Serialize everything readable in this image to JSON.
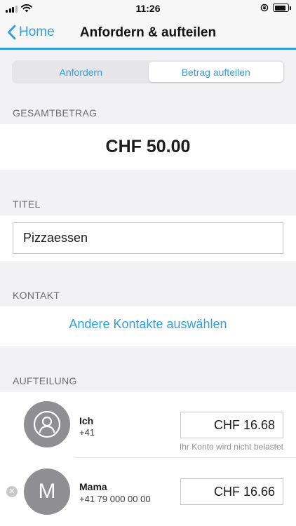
{
  "status_bar": {
    "time": "11:26"
  },
  "nav": {
    "back_label": "Home",
    "title": "Anfordern & aufteilen"
  },
  "segments": [
    {
      "label": "Anfordern",
      "active": false
    },
    {
      "label": "Betrag aufteilen",
      "active": true
    }
  ],
  "total": {
    "label": "GESAMTBETRAG",
    "value": "CHF 50.00"
  },
  "title_section": {
    "label": "TITEL",
    "value": "Pizzaessen"
  },
  "contact_section": {
    "label": "KONTAKT",
    "link": "Andere Kontakte auswählen"
  },
  "split_section": {
    "label": "AUFTEILUNG",
    "people": [
      {
        "name": "Ich",
        "phone": "+41",
        "amount": "CHF 16.68",
        "note": "Ihr Konto wird nicht belastet",
        "avatar": "person-icon"
      },
      {
        "name": "Mama",
        "phone": "+41 79 000 00 00",
        "amount": "CHF 16.66",
        "avatar_letter": "M"
      }
    ]
  },
  "colors": {
    "accent": "#2f9fe0",
    "background": "#f2f2f4",
    "avatar": "#8e8e93"
  }
}
